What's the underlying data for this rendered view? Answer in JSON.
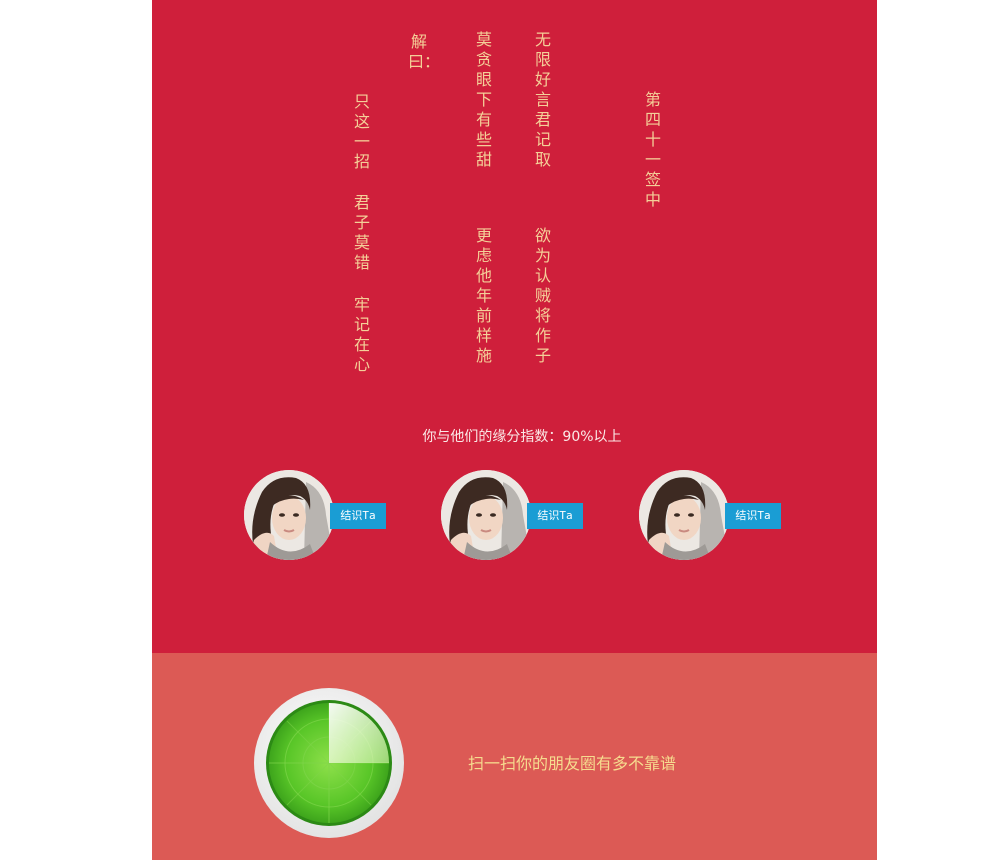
{
  "fortune": {
    "title": "第四十一签　中",
    "poem": {
      "col1_top": "无限好言君记取",
      "col1_bottom": "欲为认贼将作子",
      "col2_top": "莫贪眼下有些甜",
      "col2_bottom": "更虑他年前样施"
    },
    "jie_label": "解曰：",
    "answer": {
      "part1": "只这一招",
      "part2": "君子莫错",
      "part3": "牢记在心"
    }
  },
  "match": {
    "text": "你与他们的缘分指数：90%以上",
    "friends": [
      {
        "button": "结识Ta"
      },
      {
        "button": "结识Ta"
      },
      {
        "button": "结识Ta"
      }
    ]
  },
  "scan": {
    "text": "扫一扫你的朋友圈有多不靠谱"
  },
  "colors": {
    "fortune_bg": "#cf1f3b",
    "scan_bg": "#dc5a55",
    "poem_text": "#f4cf98",
    "button_bg": "#1a9dd4",
    "radar_green": "#5ccb2a"
  },
  "icons": {
    "avatar": "avatar-photo",
    "radar": "radar-scan-icon"
  }
}
